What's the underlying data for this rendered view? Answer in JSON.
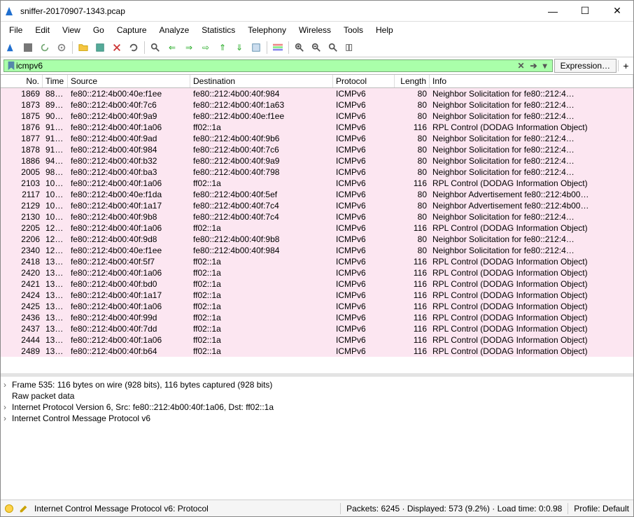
{
  "window": {
    "title": "sniffer-20170907-1343.pcap"
  },
  "menu": [
    "File",
    "Edit",
    "View",
    "Go",
    "Capture",
    "Analyze",
    "Statistics",
    "Telephony",
    "Wireless",
    "Tools",
    "Help"
  ],
  "filter": {
    "value": "icmpv6",
    "expression_label": "Expression…"
  },
  "columns": [
    "No.",
    "Time",
    "Source",
    "Destination",
    "Protocol",
    "Length",
    "Info"
  ],
  "packets": [
    {
      "no": "1869",
      "time": "88…",
      "src": "fe80::212:4b00:40e:f1ee",
      "dst": "fe80::212:4b00:40f:984",
      "proto": "ICMPv6",
      "len": "80",
      "info": "Neighbor Solicitation for fe80::212:4…"
    },
    {
      "no": "1873",
      "time": "89…",
      "src": "fe80::212:4b00:40f:7c6",
      "dst": "fe80::212:4b00:40f:1a63",
      "proto": "ICMPv6",
      "len": "80",
      "info": "Neighbor Solicitation for fe80::212:4…"
    },
    {
      "no": "1875",
      "time": "90…",
      "src": "fe80::212:4b00:40f:9a9",
      "dst": "fe80::212:4b00:40e:f1ee",
      "proto": "ICMPv6",
      "len": "80",
      "info": "Neighbor Solicitation for fe80::212:4…"
    },
    {
      "no": "1876",
      "time": "91…",
      "src": "fe80::212:4b00:40f:1a06",
      "dst": "ff02::1a",
      "proto": "ICMPv6",
      "len": "116",
      "info": "RPL Control (DODAG Information Object)"
    },
    {
      "no": "1877",
      "time": "91…",
      "src": "fe80::212:4b00:40f:9ad",
      "dst": "fe80::212:4b00:40f:9b6",
      "proto": "ICMPv6",
      "len": "80",
      "info": "Neighbor Solicitation for fe80::212:4…"
    },
    {
      "no": "1878",
      "time": "91…",
      "src": "fe80::212:4b00:40f:984",
      "dst": "fe80::212:4b00:40f:7c6",
      "proto": "ICMPv6",
      "len": "80",
      "info": "Neighbor Solicitation for fe80::212:4…"
    },
    {
      "no": "1886",
      "time": "94…",
      "src": "fe80::212:4b00:40f:b32",
      "dst": "fe80::212:4b00:40f:9a9",
      "proto": "ICMPv6",
      "len": "80",
      "info": "Neighbor Solicitation for fe80::212:4…"
    },
    {
      "no": "2005",
      "time": "98…",
      "src": "fe80::212:4b00:40f:ba3",
      "dst": "fe80::212:4b00:40f:798",
      "proto": "ICMPv6",
      "len": "80",
      "info": "Neighbor Solicitation for fe80::212:4…"
    },
    {
      "no": "2103",
      "time": "10…",
      "src": "fe80::212:4b00:40f:1a06",
      "dst": "ff02::1a",
      "proto": "ICMPv6",
      "len": "116",
      "info": "RPL Control (DODAG Information Object)"
    },
    {
      "no": "2117",
      "time": "10…",
      "src": "fe80::212:4b00:40e:f1da",
      "dst": "fe80::212:4b00:40f:5ef",
      "proto": "ICMPv6",
      "len": "80",
      "info": "Neighbor Advertisement fe80::212:4b00…"
    },
    {
      "no": "2129",
      "time": "10…",
      "src": "fe80::212:4b00:40f:1a17",
      "dst": "fe80::212:4b00:40f:7c4",
      "proto": "ICMPv6",
      "len": "80",
      "info": "Neighbor Advertisement fe80::212:4b00…"
    },
    {
      "no": "2130",
      "time": "10…",
      "src": "fe80::212:4b00:40f:9b8",
      "dst": "fe80::212:4b00:40f:7c4",
      "proto": "ICMPv6",
      "len": "80",
      "info": "Neighbor Solicitation for fe80::212:4…"
    },
    {
      "no": "2205",
      "time": "12…",
      "src": "fe80::212:4b00:40f:1a06",
      "dst": "ff02::1a",
      "proto": "ICMPv6",
      "len": "116",
      "info": "RPL Control (DODAG Information Object)"
    },
    {
      "no": "2206",
      "time": "12…",
      "src": "fe80::212:4b00:40f:9d8",
      "dst": "fe80::212:4b00:40f:9b8",
      "proto": "ICMPv6",
      "len": "80",
      "info": "Neighbor Solicitation for fe80::212:4…"
    },
    {
      "no": "2340",
      "time": "12…",
      "src": "fe80::212:4b00:40e:f1ee",
      "dst": "fe80::212:4b00:40f:984",
      "proto": "ICMPv6",
      "len": "80",
      "info": "Neighbor Solicitation for fe80::212:4…"
    },
    {
      "no": "2418",
      "time": "13…",
      "src": "fe80::212:4b00:40f:5f7",
      "dst": "ff02::1a",
      "proto": "ICMPv6",
      "len": "116",
      "info": "RPL Control (DODAG Information Object)"
    },
    {
      "no": "2420",
      "time": "13…",
      "src": "fe80::212:4b00:40f:1a06",
      "dst": "ff02::1a",
      "proto": "ICMPv6",
      "len": "116",
      "info": "RPL Control (DODAG Information Object)"
    },
    {
      "no": "2421",
      "time": "13…",
      "src": "fe80::212:4b00:40f:bd0",
      "dst": "ff02::1a",
      "proto": "ICMPv6",
      "len": "116",
      "info": "RPL Control (DODAG Information Object)"
    },
    {
      "no": "2424",
      "time": "13…",
      "src": "fe80::212:4b00:40f:1a17",
      "dst": "ff02::1a",
      "proto": "ICMPv6",
      "len": "116",
      "info": "RPL Control (DODAG Information Object)"
    },
    {
      "no": "2425",
      "time": "13…",
      "src": "fe80::212:4b00:40f:1a06",
      "dst": "ff02::1a",
      "proto": "ICMPv6",
      "len": "116",
      "info": "RPL Control (DODAG Information Object)"
    },
    {
      "no": "2436",
      "time": "13…",
      "src": "fe80::212:4b00:40f:99d",
      "dst": "ff02::1a",
      "proto": "ICMPv6",
      "len": "116",
      "info": "RPL Control (DODAG Information Object)"
    },
    {
      "no": "2437",
      "time": "13…",
      "src": "fe80::212:4b00:40f:7dd",
      "dst": "ff02::1a",
      "proto": "ICMPv6",
      "len": "116",
      "info": "RPL Control (DODAG Information Object)"
    },
    {
      "no": "2444",
      "time": "13…",
      "src": "fe80::212:4b00:40f:1a06",
      "dst": "ff02::1a",
      "proto": "ICMPv6",
      "len": "116",
      "info": "RPL Control (DODAG Information Object)"
    },
    {
      "no": "2489",
      "time": "13…",
      "src": "fe80::212:4b00:40f:b64",
      "dst": "ff02::1a",
      "proto": "ICMPv6",
      "len": "116",
      "info": "RPL Control (DODAG Information Object)"
    }
  ],
  "details": [
    "Frame 535: 116 bytes on wire (928 bits), 116 bytes captured (928 bits)",
    "Raw packet data",
    "Internet Protocol Version 6, Src: fe80::212:4b00:40f:1a06, Dst: ff02::1a",
    "Internet Control Message Protocol v6"
  ],
  "status": {
    "left": "Internet Control Message Protocol v6: Protocol",
    "stats": "Packets: 6245 · Displayed: 573 (9.2%) · Load time: 0:0.98",
    "profile": "Profile: Default"
  }
}
